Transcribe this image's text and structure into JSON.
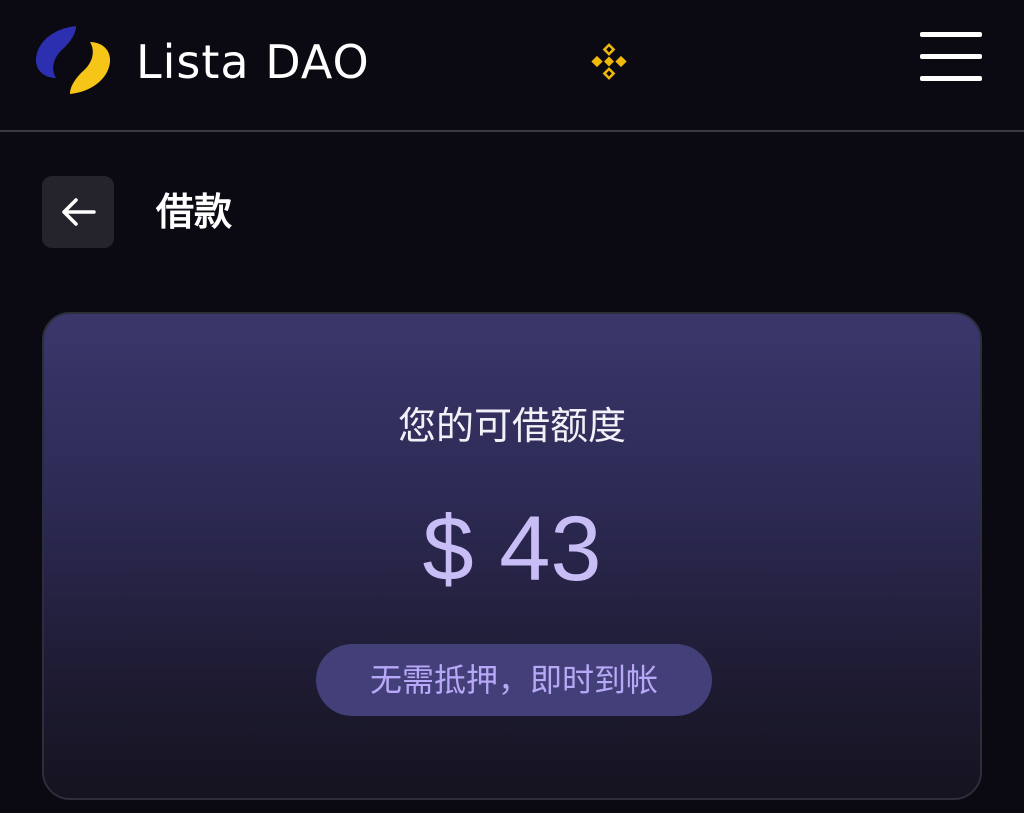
{
  "header": {
    "brand_name": "Lista DAO",
    "logo_icon": "lista-dao-logo",
    "chain_icon": "binance-bnb-icon",
    "menu_icon": "hamburger-menu-icon"
  },
  "page": {
    "back_icon": "arrow-left-icon",
    "title": "借款"
  },
  "credit_card": {
    "label": "您的可借额度",
    "amount": "$ 43",
    "promo_badge": "无需抵押，即时到帐"
  },
  "colors": {
    "background": "#0b0a12",
    "card_top": "#3a376b",
    "card_bottom": "#15131f",
    "amount": "#c9bdf6",
    "badge_bg": "#433f78",
    "badge_text": "#b7a9f7",
    "logo_blue": "#2b2fb0",
    "logo_yellow": "#f5c518",
    "bnb_yellow": "#f0b90b"
  }
}
